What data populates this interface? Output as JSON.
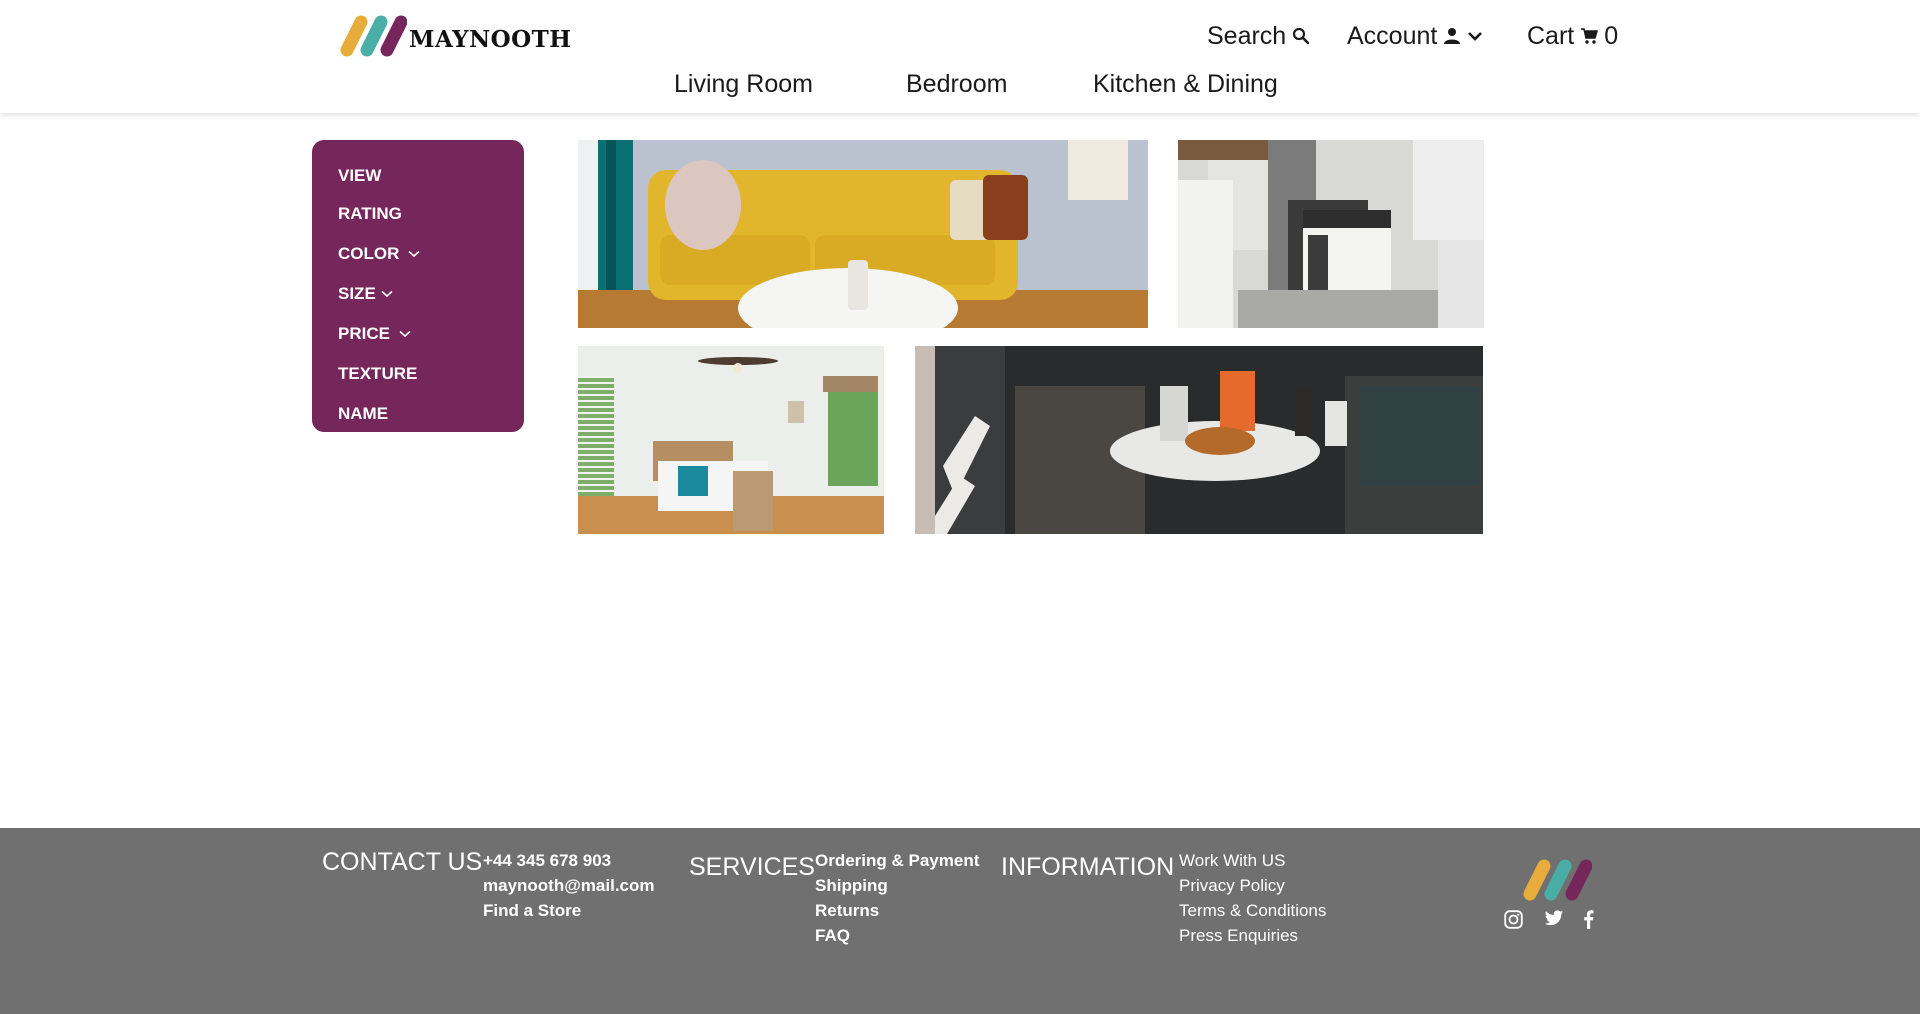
{
  "header": {
    "brand": "MAYNOOTH",
    "logo_icon": "maynooth-stripes-logo",
    "utility": {
      "search_label": "Search",
      "search_icon": "search-icon",
      "account_label": "Account",
      "account_icon": "person-icon",
      "account_dropdown_icon": "chevron-down-icon",
      "cart_label": "Cart",
      "cart_icon": "cart-icon",
      "cart_count": "0"
    },
    "nav": [
      {
        "label": "Living Room"
      },
      {
        "label": "Bedroom"
      },
      {
        "label": "Kitchen & Dining"
      }
    ]
  },
  "sidebar": {
    "items": [
      {
        "label": "VIEW",
        "has_dropdown": false
      },
      {
        "label": "RATING",
        "has_dropdown": false
      },
      {
        "label": "COLOR",
        "has_dropdown": true
      },
      {
        "label": "SIZE",
        "has_dropdown": true
      },
      {
        "label": "PRICE",
        "has_dropdown": true
      },
      {
        "label": "TEXTURE",
        "has_dropdown": false
      },
      {
        "label": "NAME",
        "has_dropdown": false
      }
    ]
  },
  "gallery": {
    "tiles": [
      {
        "alt": "Yellow sofa in living room"
      },
      {
        "alt": "Kitchen with white stove"
      },
      {
        "alt": "Bright bedroom with ceiling fan"
      },
      {
        "alt": "Breakfast on balcony table"
      }
    ]
  },
  "footer": {
    "contact": {
      "heading": "CONTACT US",
      "items": [
        "+44 345 678 903",
        "maynooth@mail.com",
        "Find a Store"
      ]
    },
    "services": {
      "heading": "SERVICES",
      "items": [
        "Ordering & Payment",
        "Shipping",
        "Returns",
        "FAQ"
      ]
    },
    "information": {
      "heading": "INFORMATION",
      "items": [
        "Work With US",
        "Privacy Policy",
        "Terms & Conditions",
        "Press Enquiries"
      ]
    },
    "social": [
      "instagram-icon",
      "twitter-icon",
      "facebook-icon"
    ]
  },
  "colors": {
    "brand_purple": "#75265a",
    "brand_teal": "#4aaea6",
    "brand_yellow": "#e8ac3c",
    "footer_bg": "#707070"
  }
}
